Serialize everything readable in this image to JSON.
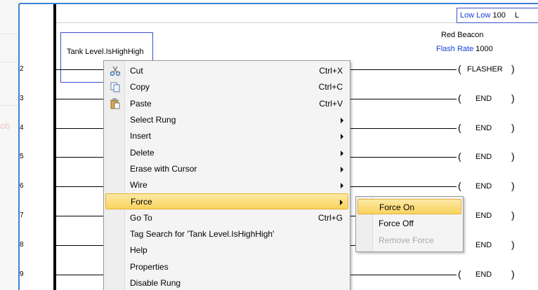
{
  "background": {
    "ghost_text": "ob"
  },
  "editor": {
    "rung_numbers": [
      "2",
      "3",
      "4",
      "5",
      "6",
      "7",
      "8",
      "9"
    ],
    "tag_contact": "Tank Level.IsHighHigh",
    "beacon_title": "Red Beacon",
    "flash_rate_label": "Flash Rate",
    "flash_rate_value": "1000",
    "lowlow_label": "Low Low",
    "lowlow_value": "100",
    "lowlow_trailing": "L",
    "coils": [
      "FLASHER",
      "END",
      "END",
      "END",
      "END",
      "END",
      "END",
      "END"
    ]
  },
  "context_menu": {
    "items": [
      {
        "label": "Cut",
        "shortcut": "Ctrl+X",
        "icon": "scissors-icon"
      },
      {
        "label": "Copy",
        "shortcut": "Ctrl+C",
        "icon": "copy-icon"
      },
      {
        "label": "Paste",
        "shortcut": "Ctrl+V",
        "icon": "paste-icon"
      },
      {
        "label": "Select Rung",
        "submenu": true
      },
      {
        "label": "Insert",
        "submenu": true
      },
      {
        "label": "Delete",
        "submenu": true
      },
      {
        "label": "Erase with Cursor",
        "submenu": true
      },
      {
        "label": "Wire",
        "submenu": true
      },
      {
        "label": "Force",
        "submenu": true,
        "highlighted": true
      },
      {
        "label": "Go To",
        "shortcut": "Ctrl+G"
      },
      {
        "label": "Tag Search for  'Tank Level.IsHighHigh'"
      },
      {
        "label": "Help"
      },
      {
        "label": "Properties"
      },
      {
        "label": "Disable Rung"
      }
    ]
  },
  "force_submenu": {
    "items": [
      {
        "label": "Force On",
        "highlighted": true
      },
      {
        "label": "Force Off"
      },
      {
        "label": "Remove Force",
        "disabled": true
      }
    ]
  },
  "colors": {
    "window_border": "#3b83d6",
    "highlight": "#f9d35e",
    "tag_blue": "#1540d8"
  }
}
